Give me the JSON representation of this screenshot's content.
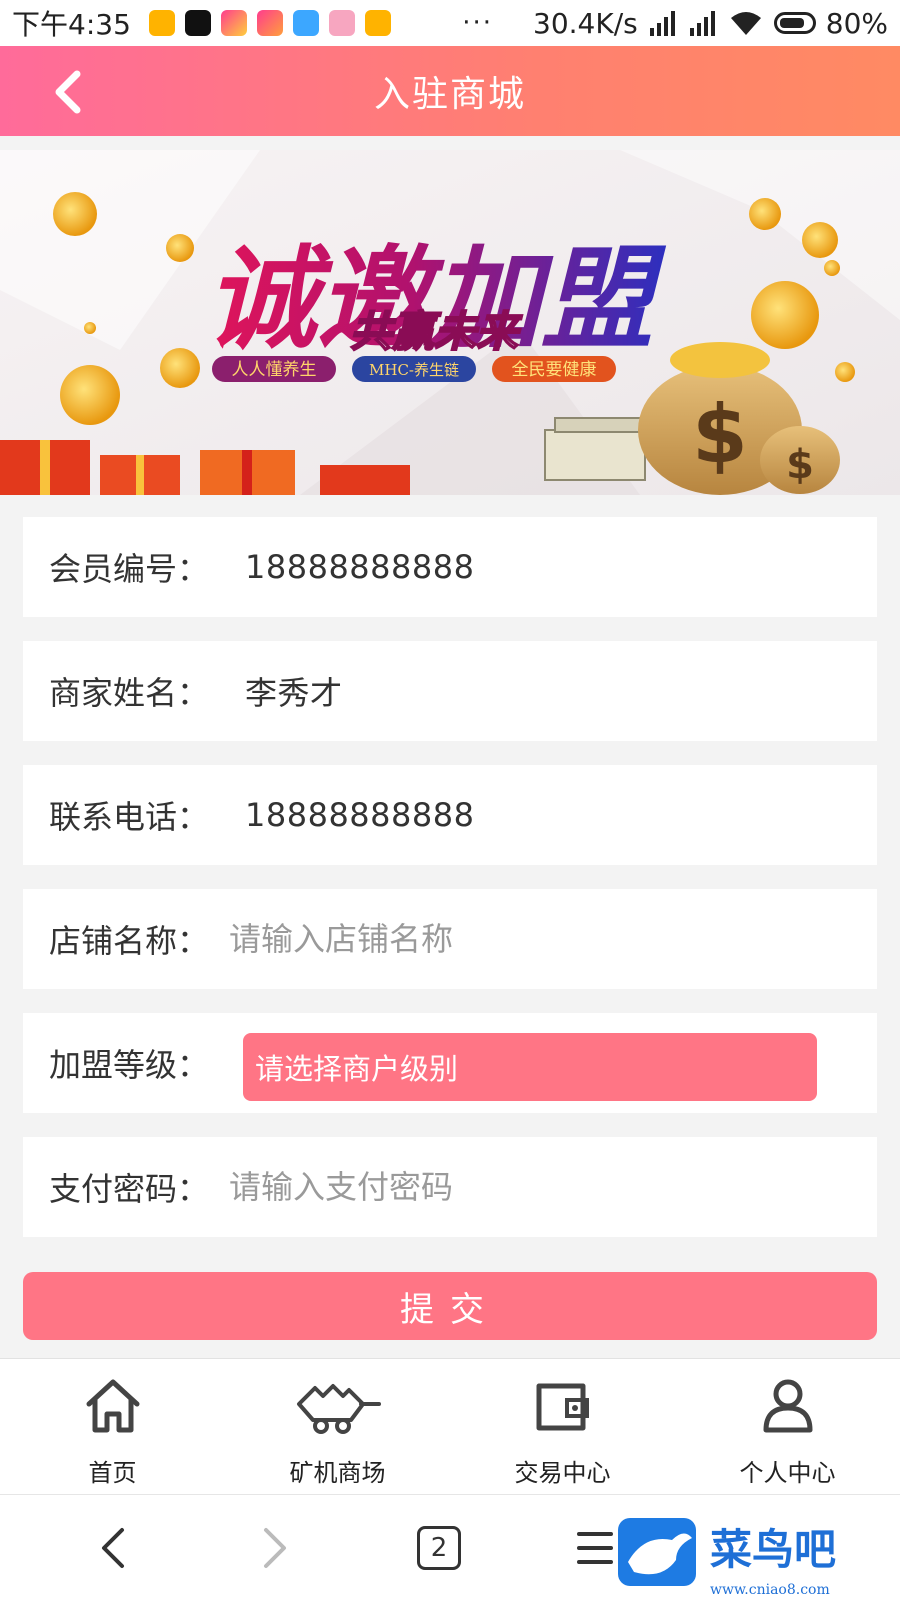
{
  "status_bar": {
    "time": "下午4:35",
    "network_speed": "30.4K/s",
    "battery": "80%",
    "more": "···"
  },
  "header": {
    "title": "入驻商城"
  },
  "banner": {
    "headline": "诚邀加盟",
    "subheadline": "共赢未来",
    "tags": [
      "人人懂养生",
      "MHC-养生链",
      "全民要健康"
    ]
  },
  "form": {
    "member_id": {
      "label": "会员编号：",
      "value": "18888888888"
    },
    "merchant_name": {
      "label": "商家姓名：",
      "value": "李秀才"
    },
    "phone": {
      "label": "联系电话：",
      "value": "18888888888"
    },
    "shop_name": {
      "label": "店铺名称：",
      "placeholder": "请输入店铺名称"
    },
    "level": {
      "label": "加盟等级：",
      "placeholder": "请选择商户级别"
    },
    "pay_password": {
      "label": "支付密码：",
      "placeholder": "请输入支付密码"
    },
    "submit_label": "提交"
  },
  "tabbar": {
    "items": [
      {
        "label": "首页",
        "icon": "home-icon"
      },
      {
        "label": "矿机商场",
        "icon": "miner-cart-icon"
      },
      {
        "label": "交易中心",
        "icon": "wallet-icon"
      },
      {
        "label": "个人中心",
        "icon": "user-icon"
      }
    ]
  },
  "browser_bar": {
    "tab_count": "2"
  },
  "watermark": {
    "text": "菜鸟吧",
    "url": "www.cniao8.com"
  },
  "colors": {
    "header_gradient_start": "#ff6b9a",
    "header_gradient_end": "#ff8a63",
    "accent": "#ff7585",
    "page_bg": "#f3f3f3"
  }
}
